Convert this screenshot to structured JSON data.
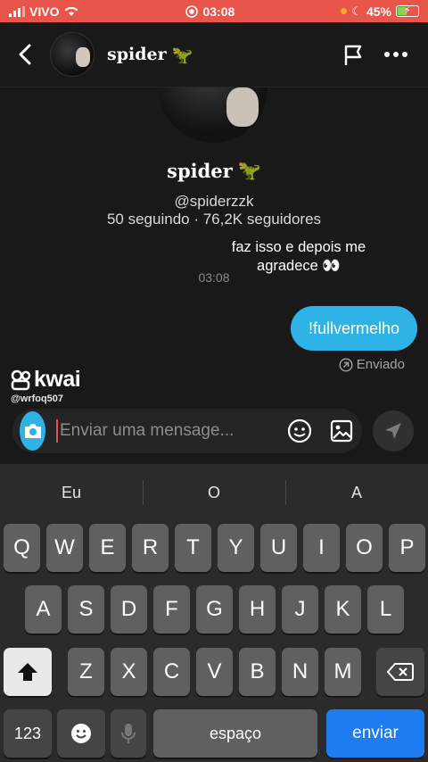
{
  "status_bar": {
    "carrier": "VIVO",
    "time": "03:08",
    "battery": "45%",
    "battery_level": 0.45
  },
  "header": {
    "name": "spider",
    "emoji": "🦖"
  },
  "profile": {
    "name": "spider",
    "emoji": "🦖",
    "handle": "@spiderzzk",
    "stats": "50 seguindo · 76,2K seguidores"
  },
  "messages": {
    "incoming_text": "faz isso e depois me agradece 👀",
    "time": "03:08",
    "outgoing_text": "!fullvermelho",
    "sent_status": "Enviado"
  },
  "watermark": {
    "brand": "kwai",
    "user": "@wrfoq507"
  },
  "composer": {
    "placeholder": "Enviar uma mensage..."
  },
  "keyboard": {
    "suggestions": [
      "Eu",
      "O",
      "A"
    ],
    "row1": [
      "Q",
      "W",
      "E",
      "R",
      "T",
      "Y",
      "U",
      "I",
      "O",
      "P"
    ],
    "row2": [
      "A",
      "S",
      "D",
      "F",
      "G",
      "H",
      "J",
      "K",
      "L"
    ],
    "row3": [
      "Z",
      "X",
      "C",
      "V",
      "B",
      "N",
      "M"
    ],
    "numbers_key": "123",
    "space_key": "espaço",
    "return_key": "enviar"
  },
  "colors": {
    "status_bar": "#e8554a",
    "accent": "#2fb3e6",
    "return_key": "#1e7cf2"
  }
}
